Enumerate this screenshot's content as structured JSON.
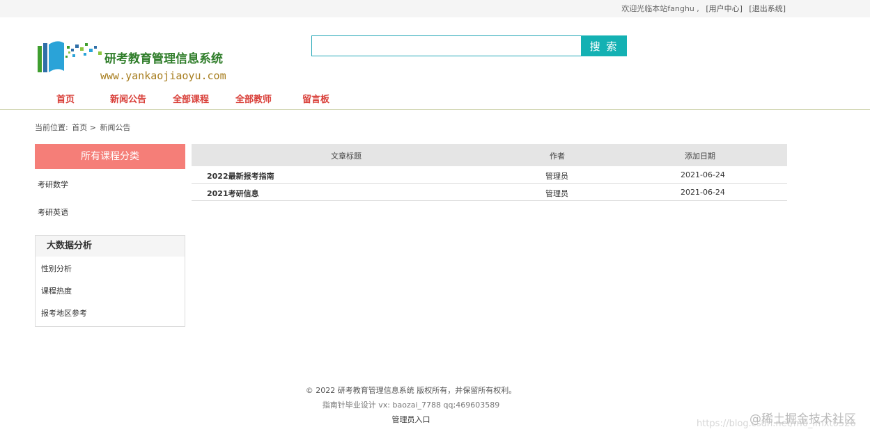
{
  "topbar": {
    "welcome": "欢迎光临本站fanghu ,",
    "user_center": "[用户中心]",
    "logout": "[退出系统]"
  },
  "logo": {
    "title": "研考教育管理信息系统",
    "url": "www.yankaojiaoyu.com"
  },
  "search": {
    "placeholder": "",
    "value": "",
    "button": "搜 索"
  },
  "nav": [
    "首页",
    "新闻公告",
    "全部课程",
    "全部教师",
    "留言板"
  ],
  "breadcrumb": {
    "prefix": "当前位置:",
    "home": "首页",
    "sep": ">",
    "current": "新闻公告"
  },
  "categories": {
    "header": "所有课程分类",
    "items": [
      "考研数学",
      "考研英语"
    ]
  },
  "bigdata": {
    "header": "大数据分析",
    "items": [
      "性别分析",
      "课程热度",
      "报考地区参考"
    ]
  },
  "table": {
    "headers": [
      "文章标题",
      "作者",
      "添加日期"
    ],
    "rows": [
      {
        "title": "2022最新报考指南",
        "author": "管理员",
        "date": "2021-06-24"
      },
      {
        "title": "2021考研信息",
        "author": "管理员",
        "date": "2021-06-24"
      }
    ]
  },
  "footer": {
    "copyright": "© 2022 研考教育管理信息系统 版权所有，并保留所有权利。",
    "credit": "指南针毕业设计 vx: baozai_7788 qq;469603589",
    "admin_link": "管理员入口"
  },
  "watermark": {
    "brand": "@稀土掘金技术社区",
    "url": "https://blog.csdn.net/m0_lmxt6526"
  },
  "colors": {
    "nav_red": "#d9403a",
    "search_teal": "#14b1b3",
    "category_salmon": "#f57e78",
    "logo_green": "#2f7d2a"
  }
}
